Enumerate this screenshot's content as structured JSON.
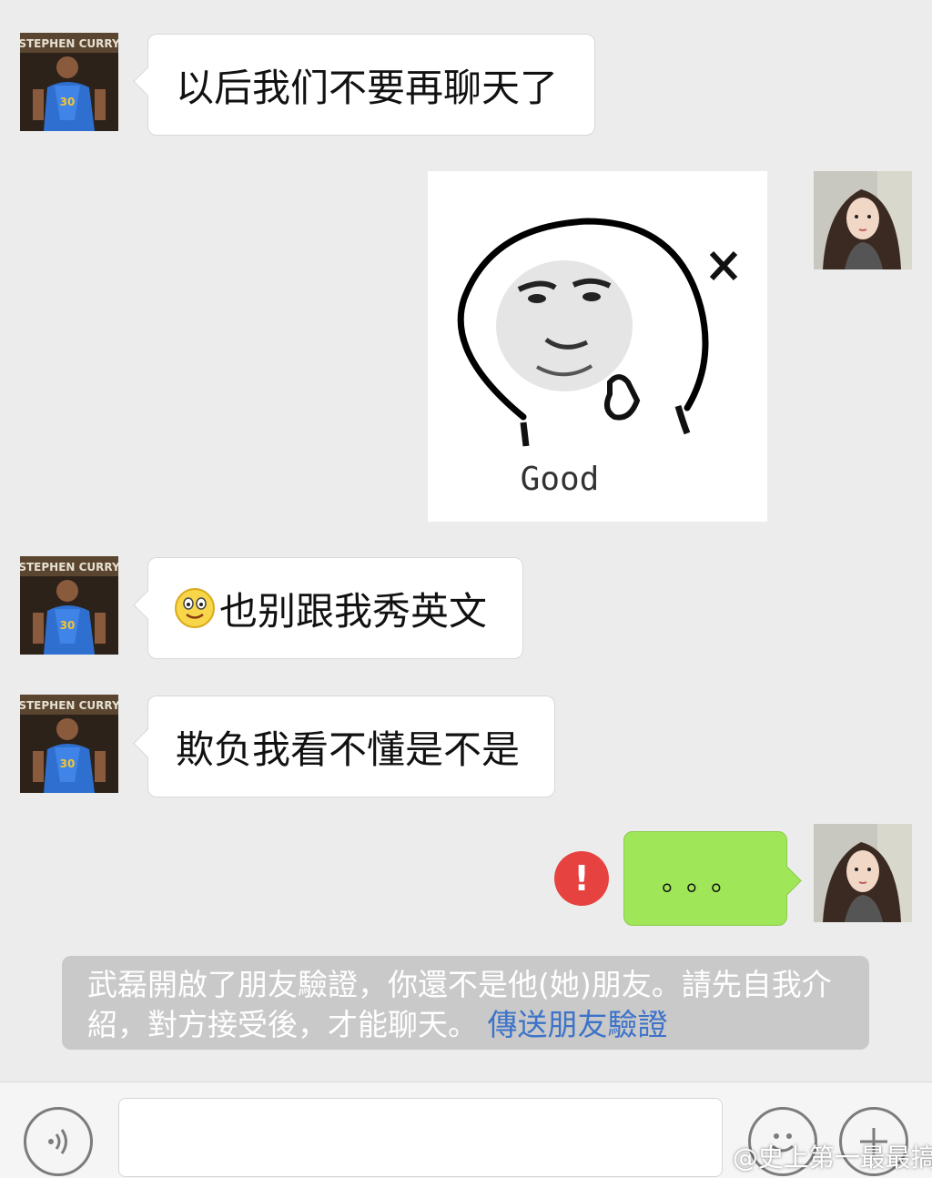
{
  "chat": {
    "messages": [
      {
        "side": "left",
        "type": "text",
        "text": "以后我们不要再聊天了"
      },
      {
        "side": "right",
        "type": "sticker",
        "sticker_caption": "Good"
      },
      {
        "side": "left",
        "type": "text",
        "emoji": "smiley-emoji",
        "text": "也别跟我秀英文"
      },
      {
        "side": "left",
        "type": "text",
        "text": "欺负我看不懂是不是"
      },
      {
        "side": "right",
        "type": "text",
        "text": "。。。",
        "status": "failed"
      }
    ],
    "avatar_left_caption": "STEPHEN CURRY",
    "avatar_left_jersey": "30"
  },
  "system_notice": {
    "text": "武磊開啟了朋友驗證，你還不是他(她)朋友。請先自我介紹，對方接受後，才能聊天。",
    "link": "傳送朋友驗證"
  },
  "input_bar": {
    "voice_icon": "voice-icon",
    "emoji_icon": "emoji-icon",
    "add_icon": "plus-icon"
  },
  "watermark": "@史上第一最最搞",
  "colors": {
    "background": "#ececec",
    "sent_bubble": "#9fe658",
    "received_bubble": "#ffffff",
    "error": "#e64340",
    "link": "#3d73c9"
  }
}
